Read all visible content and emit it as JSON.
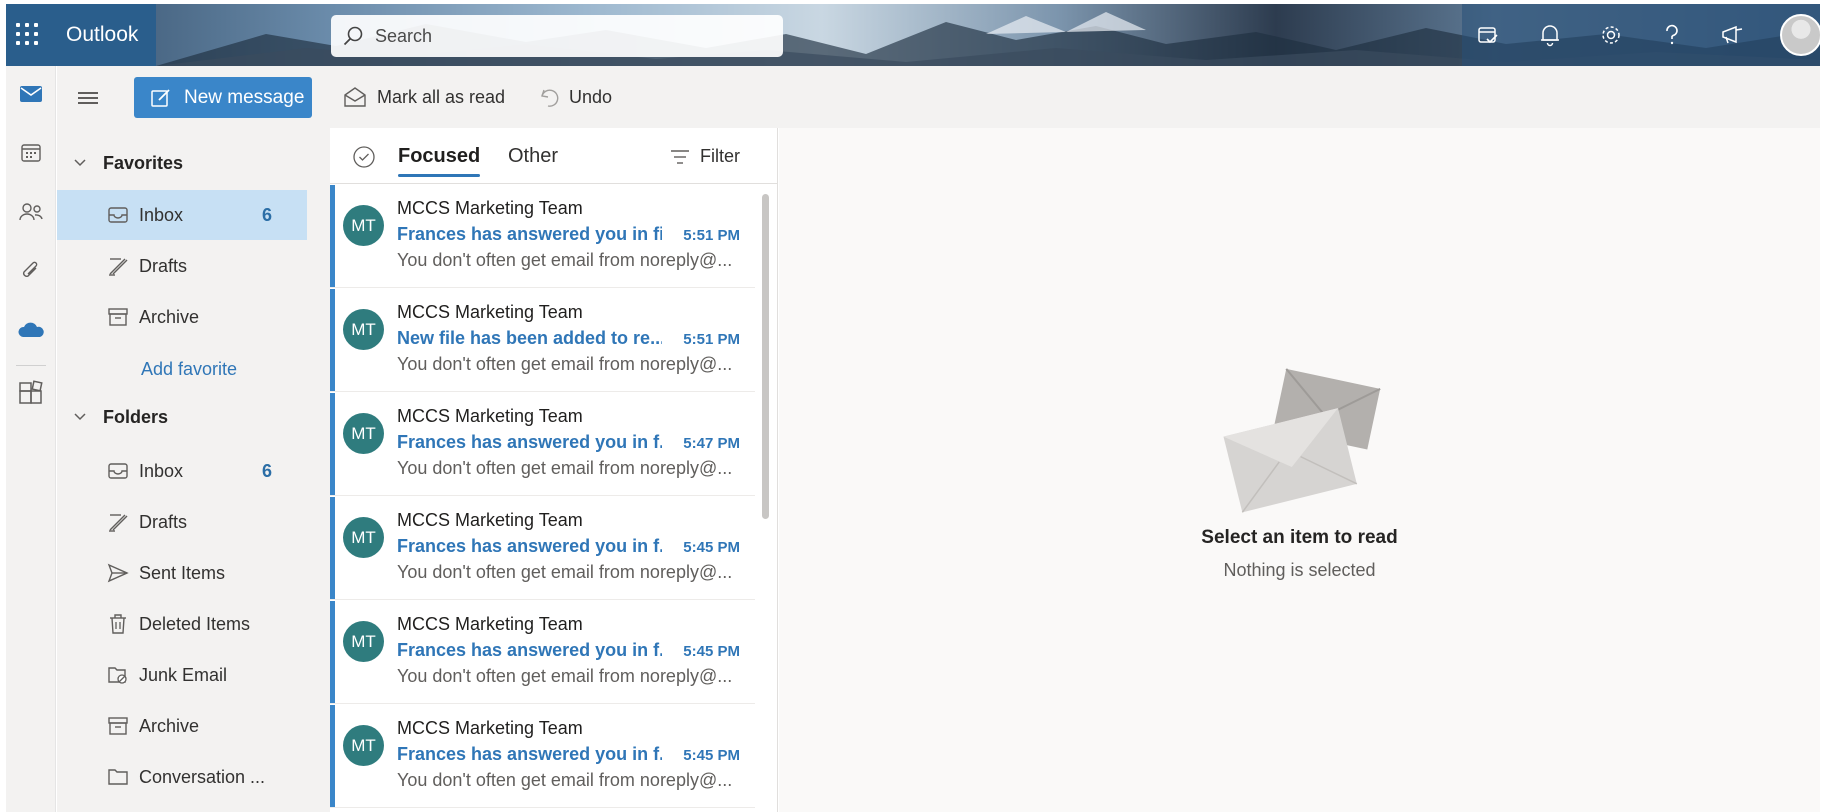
{
  "header": {
    "app_name": "Outlook",
    "search_placeholder": "Search",
    "icons": [
      "waffle-icon",
      "my-day-icon",
      "bell-icon",
      "gear-icon",
      "help-icon",
      "feedback-icon",
      "profile-avatar"
    ]
  },
  "rail": {
    "items": [
      "mail-icon",
      "calendar-icon",
      "people-icon",
      "attach-icon",
      "onedrive-icon",
      "office-apps-icon"
    ]
  },
  "toolbar": {
    "new_message": "New message",
    "mark_all_read": "Mark all as read",
    "undo": "Undo"
  },
  "favorites": {
    "title": "Favorites",
    "items": [
      {
        "label": "Inbox",
        "count": "6",
        "selected": true
      },
      {
        "label": "Drafts",
        "count": ""
      },
      {
        "label": "Archive",
        "count": ""
      }
    ],
    "add_favorite": "Add favorite"
  },
  "folders": {
    "title": "Folders",
    "items": [
      {
        "label": "Inbox",
        "count": "6"
      },
      {
        "label": "Drafts",
        "count": ""
      },
      {
        "label": "Sent Items",
        "count": ""
      },
      {
        "label": "Deleted Items",
        "count": ""
      },
      {
        "label": "Junk Email",
        "count": ""
      },
      {
        "label": "Archive",
        "count": ""
      },
      {
        "label": "Conversation ...",
        "count": ""
      }
    ]
  },
  "message_list": {
    "tabs": [
      "Focused",
      "Other"
    ],
    "active_tab": "Focused",
    "filter": "Filter",
    "messages": [
      {
        "initials": "MT",
        "sender": "MCCS Marketing Team",
        "subject": "Frances has answered you in fi...",
        "time": "5:51 PM",
        "preview": "You don't often get email from noreply@..."
      },
      {
        "initials": "MT",
        "sender": "MCCS Marketing Team",
        "subject": "New file has been added to re...",
        "time": "5:51 PM",
        "preview": "You don't often get email from noreply@..."
      },
      {
        "initials": "MT",
        "sender": "MCCS Marketing Team",
        "subject": "Frances has answered you in f...",
        "time": "5:47 PM",
        "preview": "You don't often get email from noreply@..."
      },
      {
        "initials": "MT",
        "sender": "MCCS Marketing Team",
        "subject": "Frances has answered you in f...",
        "time": "5:45 PM",
        "preview": "You don't often get email from noreply@..."
      },
      {
        "initials": "MT",
        "sender": "MCCS Marketing Team",
        "subject": "Frances has answered you in f...",
        "time": "5:45 PM",
        "preview": "You don't often get email from noreply@..."
      },
      {
        "initials": "MT",
        "sender": "MCCS Marketing Team",
        "subject": "Frances has answered you in f...",
        "time": "5:45 PM",
        "preview": "You don't often get email from noreply@..."
      }
    ]
  },
  "reading_pane": {
    "title": "Select an item to read",
    "subtitle": "Nothing is selected"
  },
  "colors": {
    "accent": "#3a86c9",
    "avatar": "#2f7c7e",
    "selected_folder": "#c7e0f4"
  }
}
